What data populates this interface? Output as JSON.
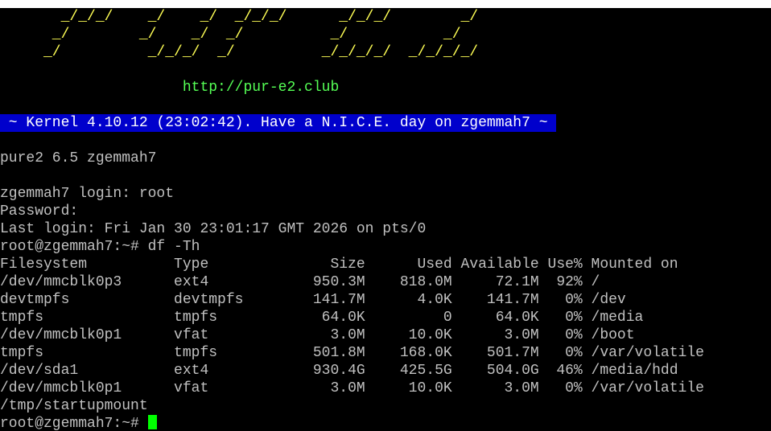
{
  "terminal": {
    "logo_lines": [
      "       _/_/_/    _/    _/  _/_/_/      _/_/_/        _/",
      "      _/        _/    _/  _/          _/           _/",
      "     _/          _/_/_/  _/          _/_/_/_/  _/_/_/_/"
    ],
    "url_line": "                     http://pur-e2.club",
    "banner": " ~ Kernel 4.10.12 (23:02:42). Have a N.I.C.E. day on zgemmah7 ~ ",
    "version_line": "pure2 6.5 zgemmah7",
    "login_line": "zgemmah7 login: root",
    "password_line": "Password:",
    "last_login_line": "Last login: Fri Jan 30 23:01:17 GMT 2026 on pts/0",
    "command_line": "root@zgemmah7:~# df -Th",
    "df_header": "Filesystem          Type              Size      Used Available Use% Mounted on",
    "df_rows": [
      "/dev/mmcblk0p3      ext4            950.3M    818.0M     72.1M  92% /",
      "devtmpfs            devtmpfs        141.7M      4.0K    141.7M   0% /dev",
      "tmpfs               tmpfs            64.0K         0     64.0K   0% /media",
      "/dev/mmcblk0p1      vfat              3.0M     10.0K      3.0M   0% /boot",
      "tmpfs               tmpfs           501.8M    168.0K    501.7M   0% /var/volatile",
      "/dev/sda1           ext4            930.4G    425.5G    504.0G  46% /media/hdd",
      "/dev/mmcblk0p1      vfat              3.0M     10.0K      3.0M   0% /var/volatile",
      "/tmp/startupmount"
    ],
    "prompt": "root@zgemmah7:~# "
  },
  "colors": {
    "background": "#000000",
    "text": "#c0c0c0",
    "logo": "#ffff55",
    "url": "#55ff55",
    "banner_bg": "#0000cc",
    "banner_fg": "#ffffff",
    "cursor": "#00ff00"
  }
}
